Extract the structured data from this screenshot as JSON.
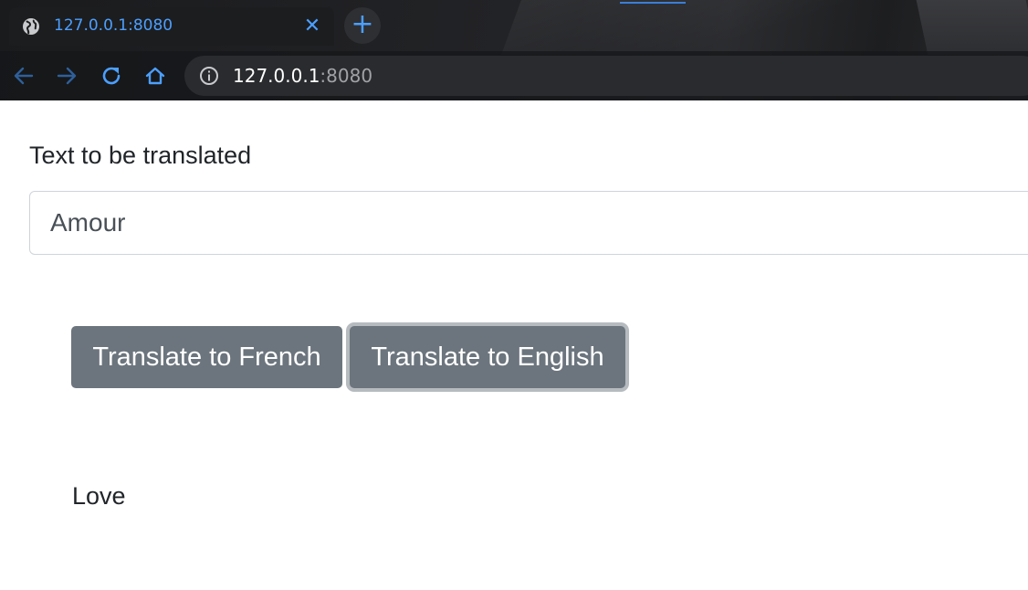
{
  "browser": {
    "tab": {
      "title": "127.0.0.1:8080",
      "favicon": "globe-icon",
      "close_icon": "close-icon"
    },
    "new_tab_icon": "plus-icon",
    "nav": {
      "back_icon": "arrow-left-icon",
      "forward_icon": "arrow-right-icon",
      "reload_icon": "reload-icon",
      "home_icon": "home-icon"
    },
    "address": {
      "info_icon": "info-icon",
      "host": "127.0.0.1",
      "port": ":8080"
    },
    "accent_color": "#4c9fff"
  },
  "page": {
    "field_label": "Text to be translated",
    "input_value": "Amour",
    "buttons": {
      "to_french": "Translate to French",
      "to_english": "Translate to English"
    },
    "button_color": "#6c757d",
    "result": "Love"
  }
}
